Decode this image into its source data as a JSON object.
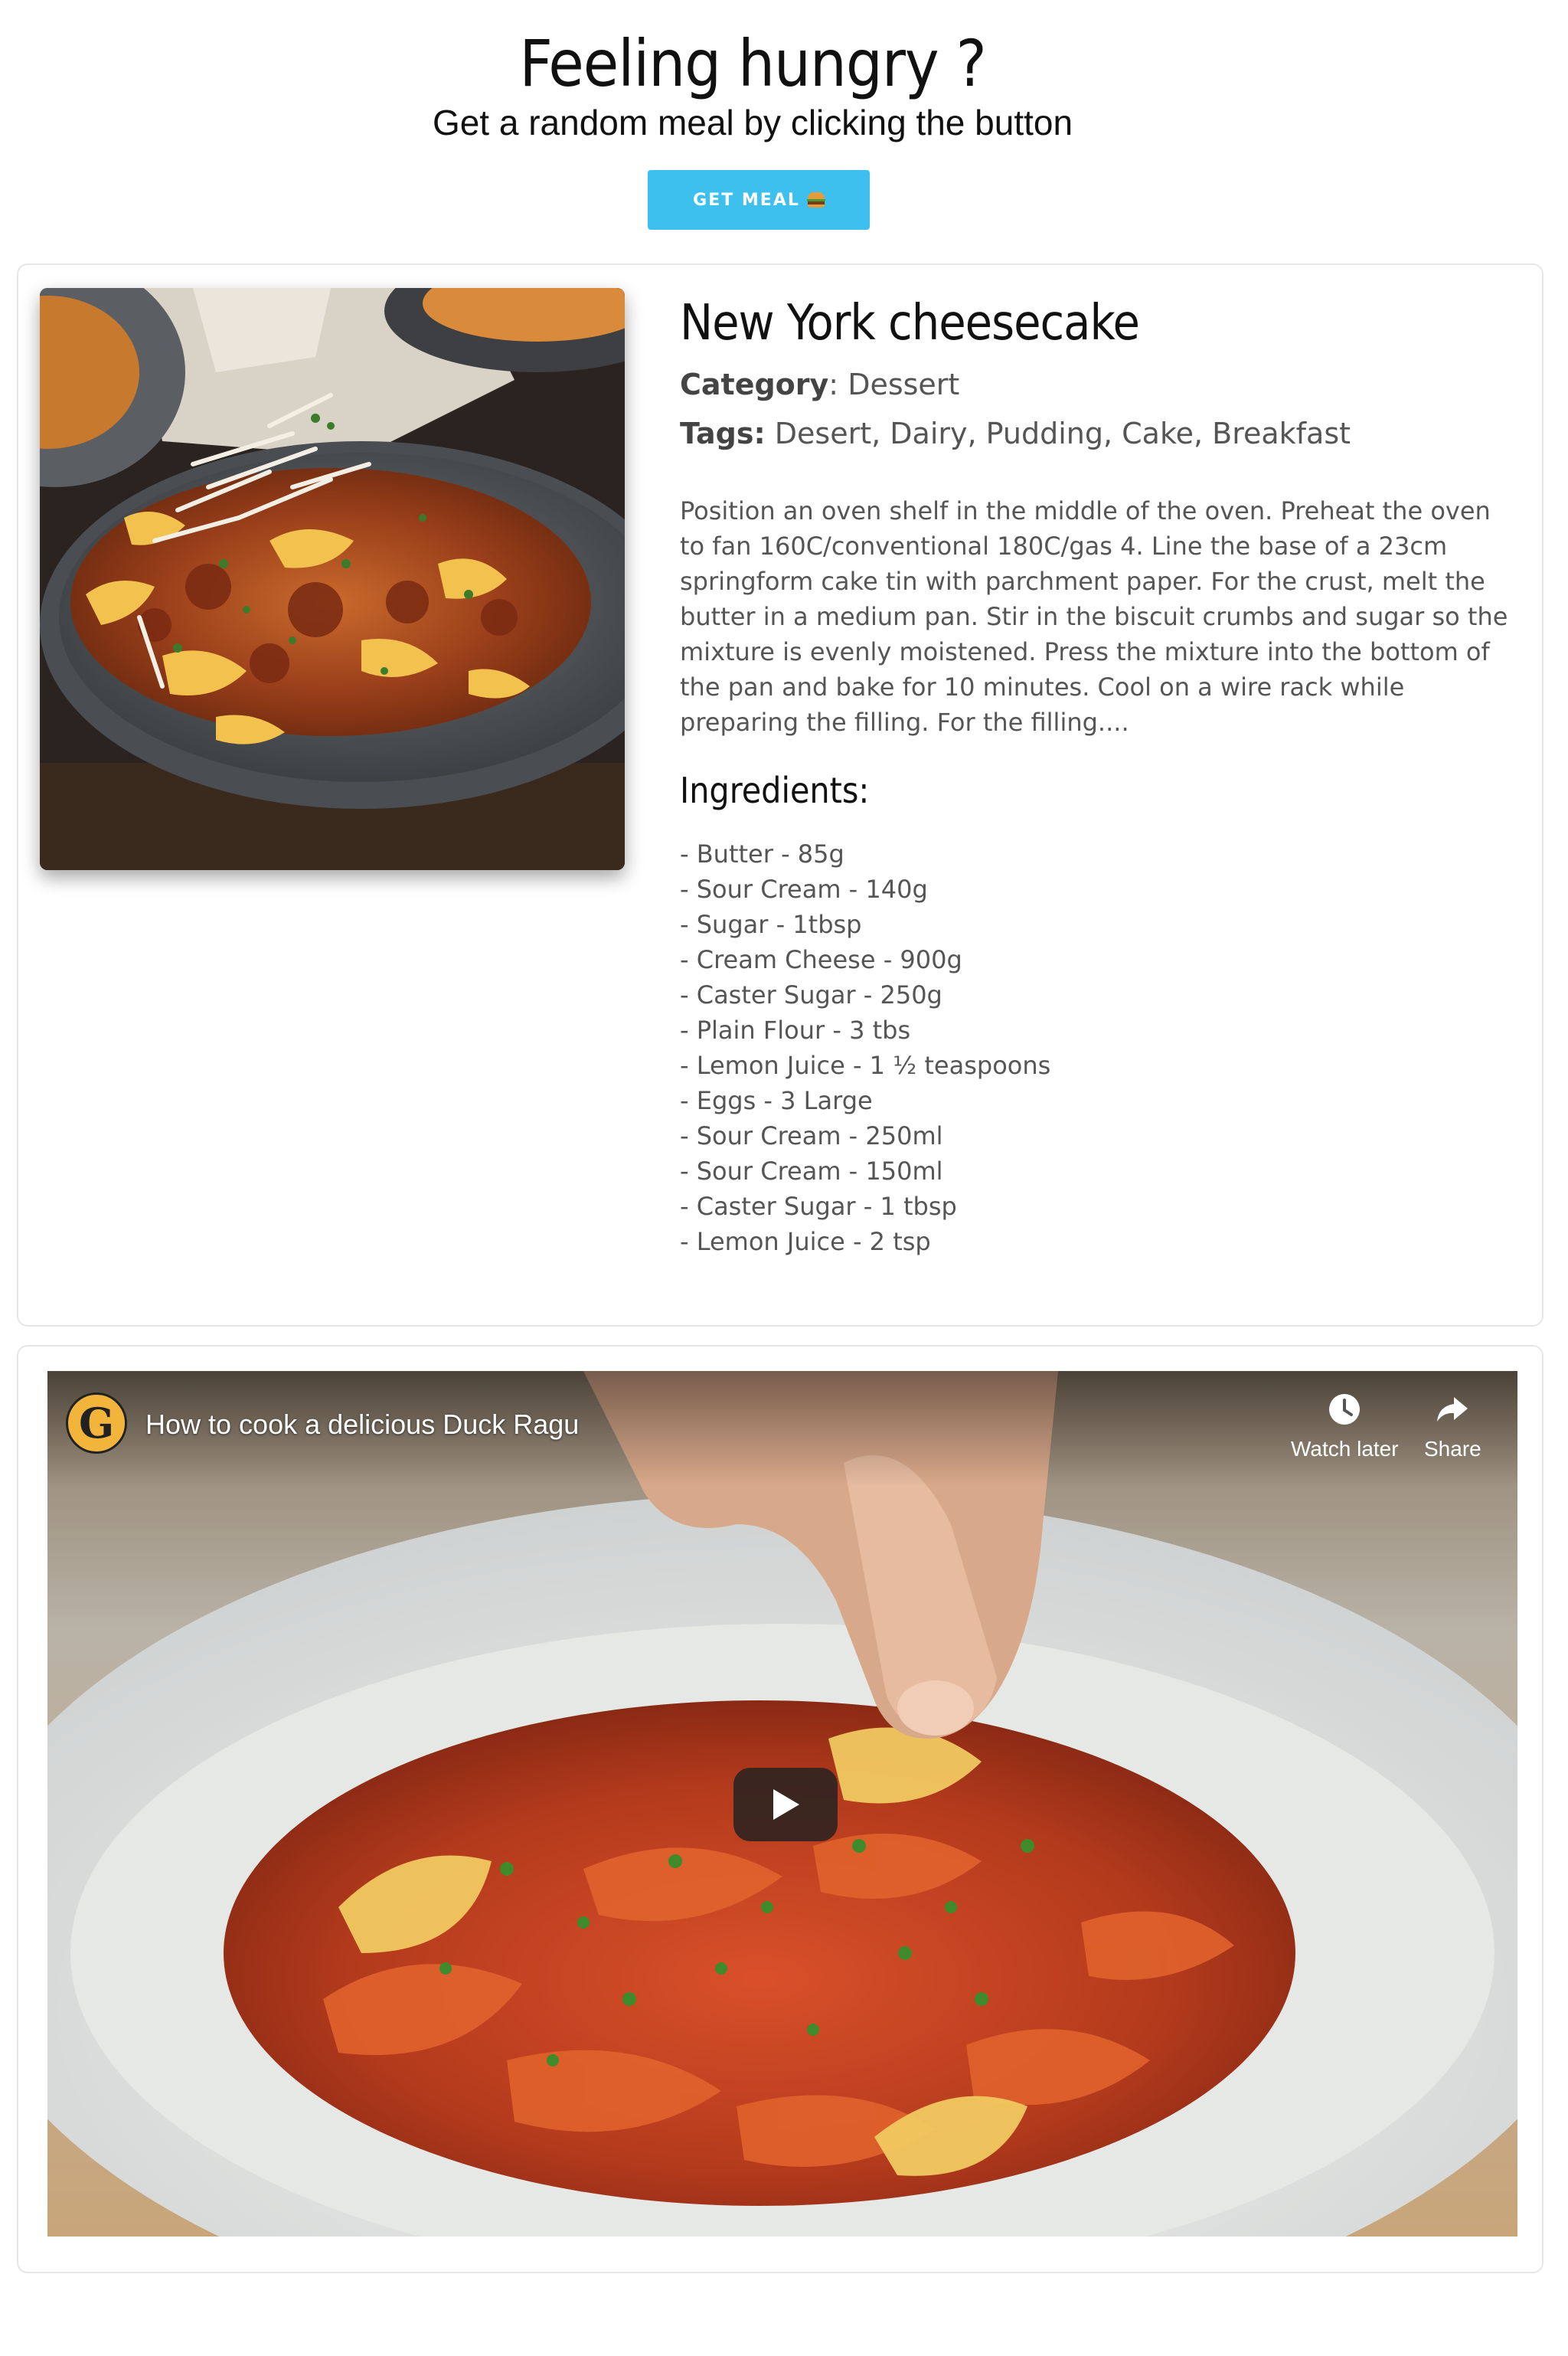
{
  "header": {
    "title": "Feeling hungry ?",
    "subtitle": "Get a random meal by clicking the button",
    "button_label": "GET MEAL",
    "button_icon": "burger-icon",
    "accent_color": "#3ec0ef"
  },
  "meal": {
    "name": "New York cheesecake",
    "category_label": "Category",
    "category": "Dessert",
    "tags_label": "Tags:",
    "tags": "Desert, Dairy, Pudding, Cake, Breakfast",
    "instructions": "Position an oven shelf in the middle of the oven. Preheat the oven to fan 160C/conventional 180C/gas 4. Line the base of a 23cm springform cake tin with parchment paper. For the crust, melt the butter in a medium pan. Stir in the biscuit crumbs and sugar so the mixture is evenly moistened. Press the mixture into the bottom of the pan and bake for 10 minutes. Cool on a wire rack while preparing the filling. For the filling....",
    "ingredients_heading": "Ingredients:",
    "ingredients": [
      "- Butter - 85g",
      "- Sour Cream - 140g",
      "- Sugar - 1tbsp",
      "- Cream Cheese - 900g",
      "- Caster Sugar - 250g",
      "- Plain Flour - 3 tbs",
      "- Lemon Juice - 1 ½ teaspoons",
      "- Eggs - 3 Large",
      "- Sour Cream - 250ml",
      "- Sour Cream - 150ml",
      "- Caster Sugar - 1 tbsp",
      "- Lemon Juice - 2 tsp"
    ]
  },
  "video": {
    "channel_logo_letter": "G",
    "title": "How to cook a delicious Duck Ragu",
    "watch_later_label": "Watch later",
    "share_label": "Share"
  }
}
